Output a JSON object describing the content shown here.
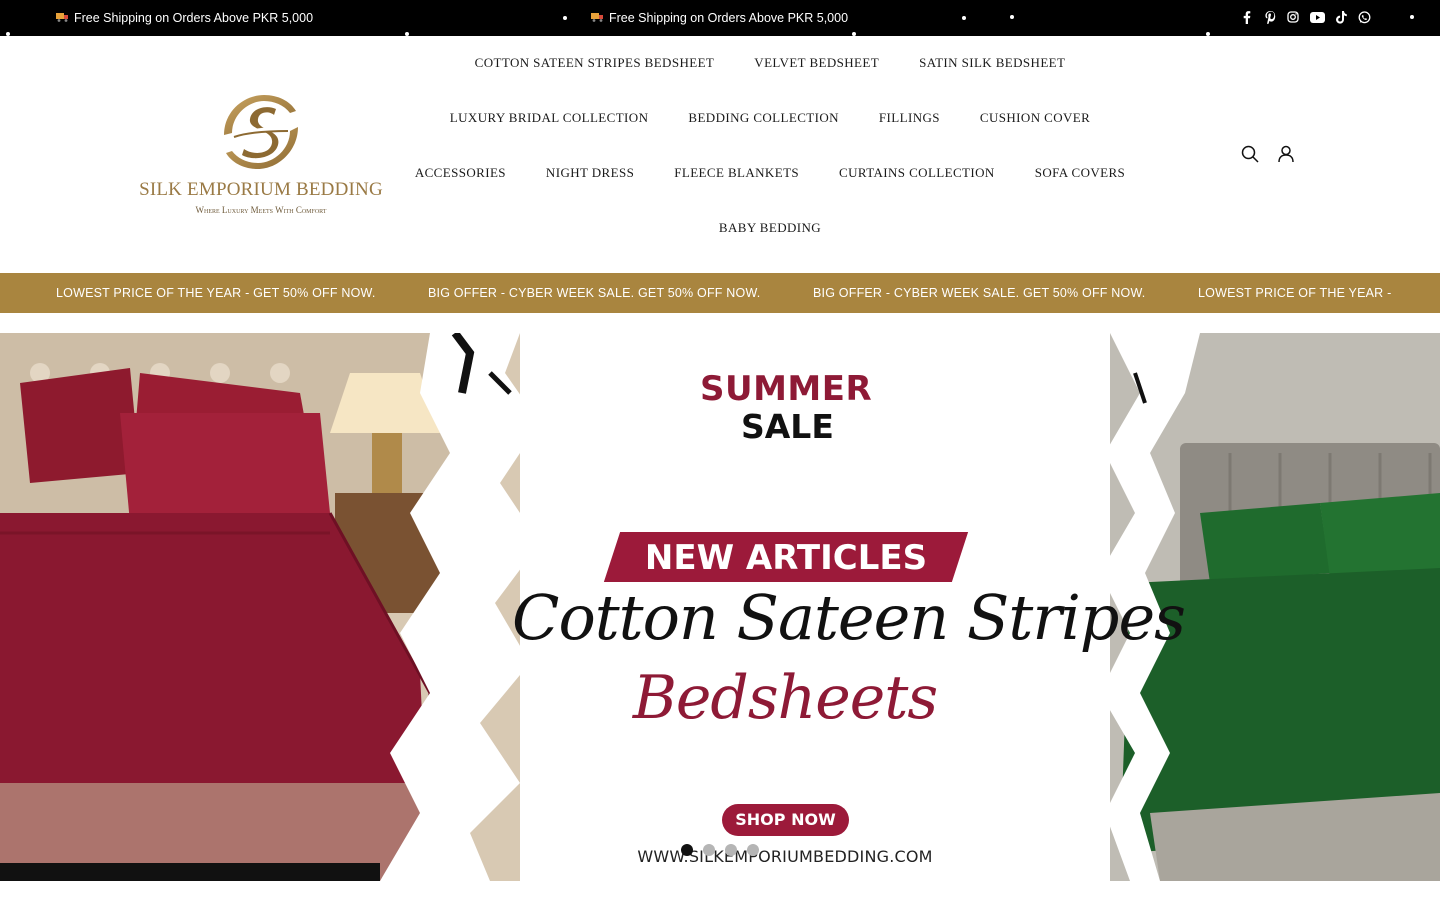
{
  "announcement": {
    "items": [
      "Free Shipping on Orders Above PKR 5,000",
      "Free Shipping on Orders Above PKR 5,000"
    ],
    "icon": "truck-icon"
  },
  "socials": [
    "facebook-icon",
    "pinterest-icon",
    "instagram-icon",
    "youtube-icon",
    "tiktok-icon",
    "whatsapp-icon"
  ],
  "logo": {
    "brand": "SILK EMPORIUM BEDDING",
    "tagline": "Where Luxury Meets With Comfort"
  },
  "nav": {
    "rows": [
      [
        "COTTON SATEEN STRIPES BEDSHEET",
        "VELVET BEDSHEET",
        "SATIN SILK BEDSHEET"
      ],
      [
        "LUXURY BRIDAL COLLECTION",
        "BEDDING COLLECTION",
        "FILLINGS",
        "CUSHION COVER"
      ],
      [
        "ACCESSORIES",
        "NIGHT DRESS",
        "FLEECE BLANKETS",
        "CURTAINS COLLECTION",
        "SOFA COVERS"
      ],
      [
        "BABY BEDDING"
      ]
    ]
  },
  "header_icons": [
    "search-icon",
    "account-icon"
  ],
  "marquee": {
    "items": [
      "LOWEST PRICE OF THE YEAR - GET 50% OFF NOW.",
      "BIG OFFER - CYBER WEEK SALE. GET 50% OFF NOW.",
      "BIG OFFER - CYBER WEEK SALE. GET 50% OFF NOW.",
      "LOWEST PRICE OF THE YEAR -"
    ],
    "color": "#a9853f"
  },
  "hero": {
    "headline1": "SUMMER",
    "headline2": "SALE",
    "badge": "NEW ARTICLES",
    "script1": "Cotton Sateen Stripes",
    "script2": "Bedsheets",
    "cta": "SHOP NOW",
    "url": "WWW.SILKEMPORIUMBEDDING.COM",
    "slides": 4,
    "active_slide": 1,
    "accent": "#9c1a3a"
  }
}
